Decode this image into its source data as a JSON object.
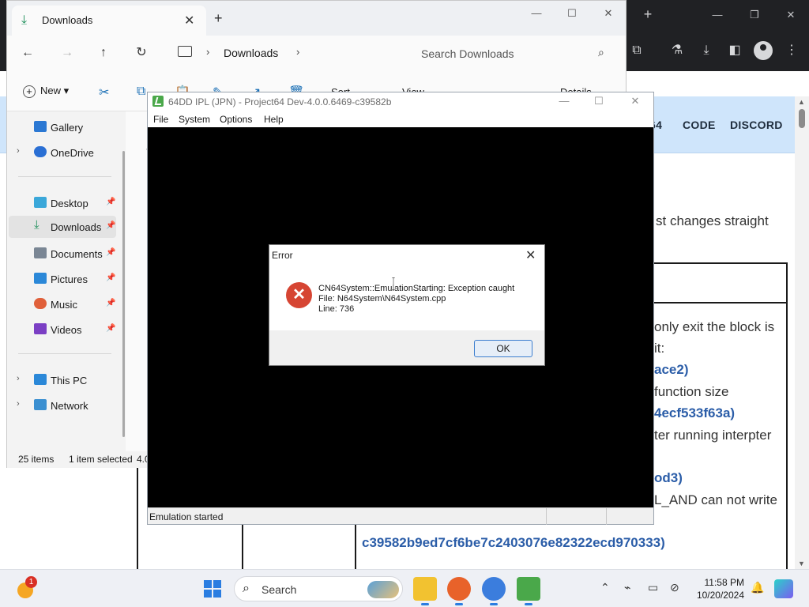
{
  "browser": {
    "new_tab_symbol": "+",
    "nav_links": [
      "64",
      "CODE",
      "DISCORD"
    ],
    "page_texts": {
      "changes": "st changes straight",
      "only_exit": "only exit the block is",
      "it": "it:",
      "ace2": "ace2)",
      "function_size": "function size",
      "commit_2": "4ecf533f63a)",
      "after_running": "ter running interpter",
      "commit_3": "od3)",
      "and_write": "L_AND can not write",
      "commit_full": "c39582b9ed7cf6be7c2403076e82322ecd970333)"
    }
  },
  "explorer": {
    "tab_title": "Downloads",
    "breadcrumb": "Downloads",
    "search_placeholder": "Search Downloads",
    "new_label": "New",
    "sort_label": "Sort",
    "view_label": "View",
    "details_label": "Details",
    "sidebar": [
      {
        "label": "Gallery",
        "color": "#2b78d3",
        "chevron": false,
        "pinned": false
      },
      {
        "label": "OneDrive",
        "color": "#2a6fd4",
        "chevron": true,
        "pinned": false
      },
      {
        "label": "Desktop",
        "color": "#3aa7d9",
        "chevron": false,
        "pinned": true
      },
      {
        "label": "Downloads",
        "color": "#1d8f5a",
        "chevron": false,
        "pinned": true,
        "selected": true
      },
      {
        "label": "Documents",
        "color": "#7a8694",
        "chevron": false,
        "pinned": true
      },
      {
        "label": "Pictures",
        "color": "#2b88d8",
        "chevron": false,
        "pinned": true
      },
      {
        "label": "Music",
        "color": "#e0603a",
        "chevron": false,
        "pinned": true
      },
      {
        "label": "Videos",
        "color": "#7b3fc4",
        "chevron": false,
        "pinned": true
      },
      {
        "label": "This PC",
        "color": "#2b88d8",
        "chevron": true,
        "pinned": false
      },
      {
        "label": "Network",
        "color": "#3a8fd1",
        "chevron": true,
        "pinned": false
      }
    ],
    "status": {
      "items": "25 items",
      "selected": "1 item selected",
      "size": "4.0"
    }
  },
  "project64": {
    "title": "64DD IPL (JPN) - Project64 Dev-4.0.0.6469-c39582b",
    "menus": [
      "File",
      "System",
      "Options",
      "Help"
    ],
    "status_text": "Emulation started"
  },
  "dialog": {
    "title": "Error",
    "line1": "CN64System::EmulationStarting: Exception caught",
    "line2": "File: N64System\\N64System.cpp",
    "line3": "Line: 736",
    "ok_label": "OK"
  },
  "taskbar": {
    "search_label": "Search",
    "weather_badge": "1",
    "time": "11:58 PM",
    "date": "10/20/2024"
  }
}
